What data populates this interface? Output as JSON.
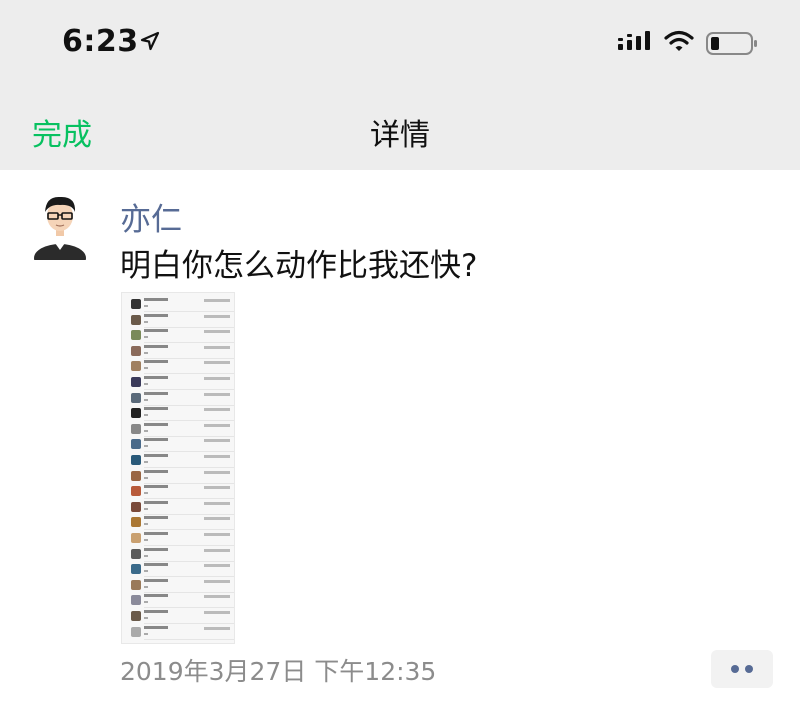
{
  "status_bar": {
    "time": "6:23",
    "icons": [
      "location-arrow-icon",
      "cellular-signal-icon",
      "wifi-icon",
      "battery-icon"
    ]
  },
  "nav": {
    "done_label": "完成",
    "title": "详情"
  },
  "post": {
    "author": "亦仁",
    "text": "明白你怎么动作比我还快?",
    "image_description_icon": "screenshot-thumbnail",
    "date": "2019年3月27日 下午12:35"
  },
  "colors": {
    "accent_green": "#07c160",
    "name_blue": "#576b95",
    "bar_bg": "#ededed",
    "meta_gray": "#8c8c8c"
  }
}
